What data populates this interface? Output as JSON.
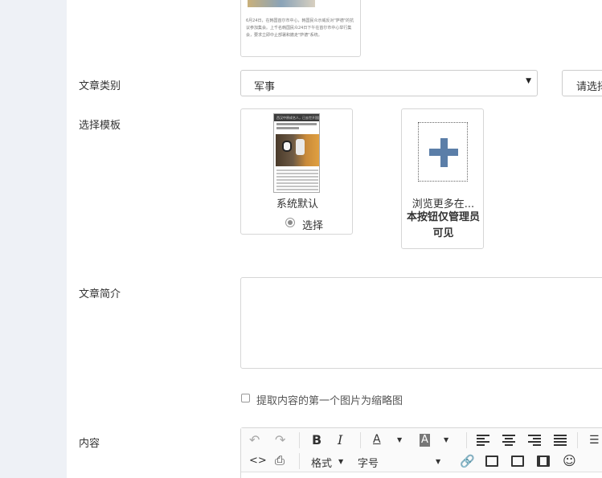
{
  "previous_card": {
    "excerpt": "6月24日，在韩国首尔市中心，韩国民众示威反对\"萨德\"的抗议参加集会。上千名韩国民众24日下午在首尔市中心举行集会，要求立即中止部署和撤走\"萨德\"系统。"
  },
  "form": {
    "category_label": "文章类别",
    "category_value": "军事",
    "second_select_placeholder": "请选择",
    "template_label": "选择模板",
    "summary_label": "文章简介",
    "thumbnail_checkbox_label": "提取内容的第一个图片为缩略图",
    "content_label": "内容"
  },
  "templates": {
    "default_name": "系统默认",
    "select_label": "选择",
    "browse_title": "浏览更多在...",
    "browse_note": "本按钮仅管理员可见",
    "phone_title": "西汉中原成名人，已去世开国团开发"
  },
  "editor": {
    "format_label": "格式",
    "font_size_label": "字号",
    "icons": [
      "undo-icon",
      "redo-icon",
      "bold-icon",
      "italic-icon",
      "font-color-icon",
      "bg-color-icon",
      "align-left-icon",
      "align-center-icon",
      "align-right-icon",
      "align-justify-icon",
      "list-icon",
      "source-code-icon",
      "print-icon",
      "link-icon",
      "image-icon",
      "multi-image-icon",
      "video-icon",
      "emoji-icon"
    ]
  },
  "colors": {
    "sidebar_bg": "#eef1f6",
    "plus_accent": "#5b7ea8",
    "border": "#d6d6d6"
  }
}
